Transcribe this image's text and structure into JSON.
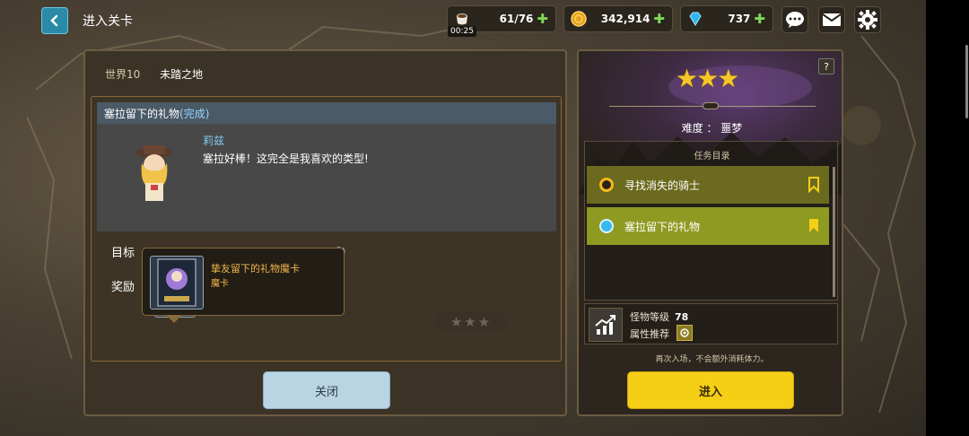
{
  "header": {
    "title": "进入关卡",
    "stamina": {
      "value": "61",
      "max": "/76",
      "timer": "00:25"
    },
    "gold": "342,914",
    "gems": "737"
  },
  "stage": {
    "world": "世界10",
    "name": "未踏之地"
  },
  "quest": {
    "title": "塞拉留下的礼物",
    "status": "(完成)",
    "speaker": "莉兹",
    "line": "塞拉好棒！这完全是我喜欢的类型!",
    "goal_label": "目标",
    "reward_label": "奖励",
    "goal_tail": "成)"
  },
  "tooltip": {
    "item_name": "挚友留下的礼物魔卡",
    "item_type": "魔卡"
  },
  "map_stars": "★★★",
  "buttons": {
    "close": "关闭",
    "enter": "进入"
  },
  "detail": {
    "stars": "★★★",
    "help": "?",
    "difficulty": "难度 ： 噩梦",
    "task_list_title": "任务目录",
    "tasks": [
      {
        "label": "寻找消失的骑士",
        "dot_color": "#f5b820"
      },
      {
        "label": "塞拉留下的礼物",
        "dot_color": "#38b9ee"
      }
    ],
    "monster_level_label": "怪物等级",
    "monster_level": "78",
    "attr_label": "属性推荐",
    "note": "再次入场，不会额外消耗体力。"
  },
  "colors": {
    "accent_yellow": "#f5cf16",
    "task_bg": "#6b6a1e",
    "task_active_bg": "#8e9a21"
  }
}
